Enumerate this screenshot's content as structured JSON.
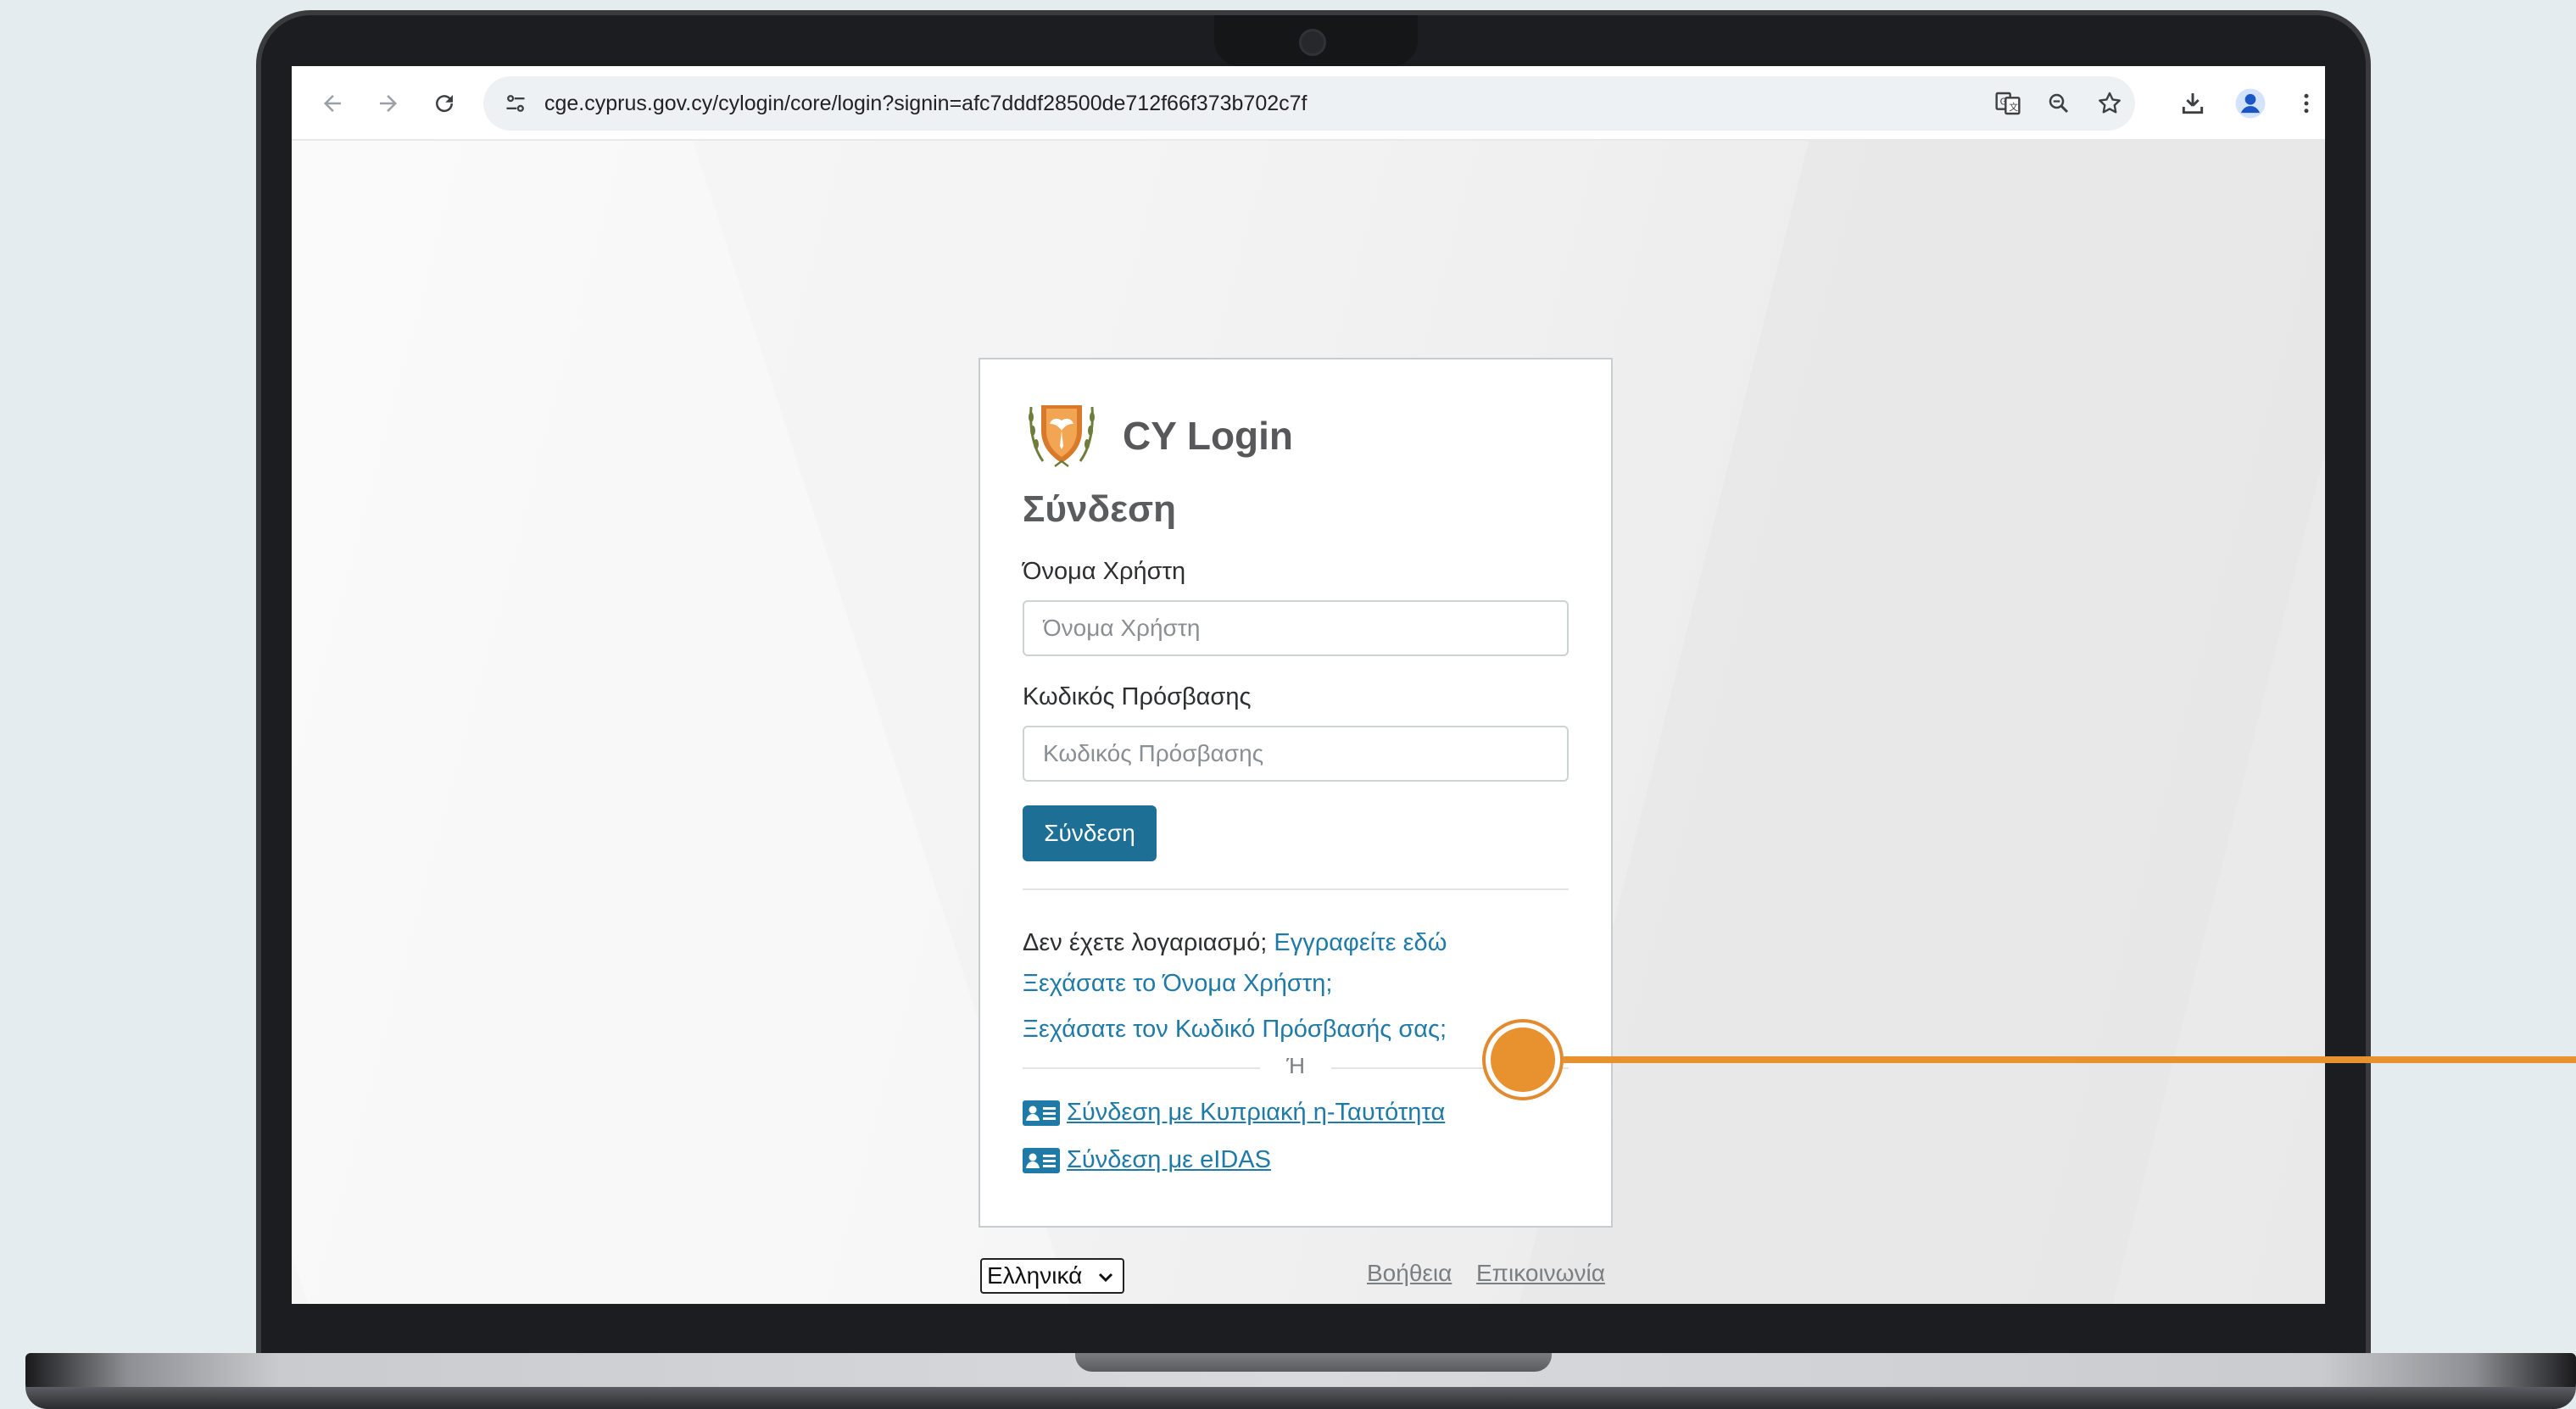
{
  "browser": {
    "url": "cge.cyprus.gov.cy/cylogin/core/login?signin=afc7dddf28500de712f66f373b702c7f",
    "icons": [
      "back-icon",
      "forward-icon",
      "reload-icon",
      "site-info-icon",
      "translate-icon",
      "zoom-icon",
      "star-icon",
      "download-icon",
      "profile-icon",
      "menu-icon"
    ]
  },
  "login": {
    "brand": "CY Login",
    "heading": "Σύνδεση",
    "username_label": "Όνομα Χρήστη",
    "username_placeholder": "Όνομα Χρήστη",
    "password_label": "Κωδικός Πρόσβασης",
    "password_placeholder": "Κωδικός Πρόσβασης",
    "submit_label": "Σύνδεση",
    "no_account_text": "Δεν έχετε λογαριασμό;",
    "register_link": "Εγγραφείτε εδώ",
    "forgot_username": "Ξεχάσατε το Όνομα Χρήστη;",
    "forgot_password": "Ξεχάσατε τον Κωδικό Πρόσβασής σας;",
    "or_text": "Ή",
    "eid_login": "Σύνδεση με Κυπριακή η-Ταυτότητα",
    "eidas_login": "Σύνδεση με eIDAS"
  },
  "footer": {
    "language": "Ελληνικά",
    "help": "Βοήθεια",
    "contact": "Επικοινωνία"
  },
  "colors": {
    "primary_button": "#1e6f96",
    "link": "#1f7aa8",
    "callout": "#e8912f"
  }
}
